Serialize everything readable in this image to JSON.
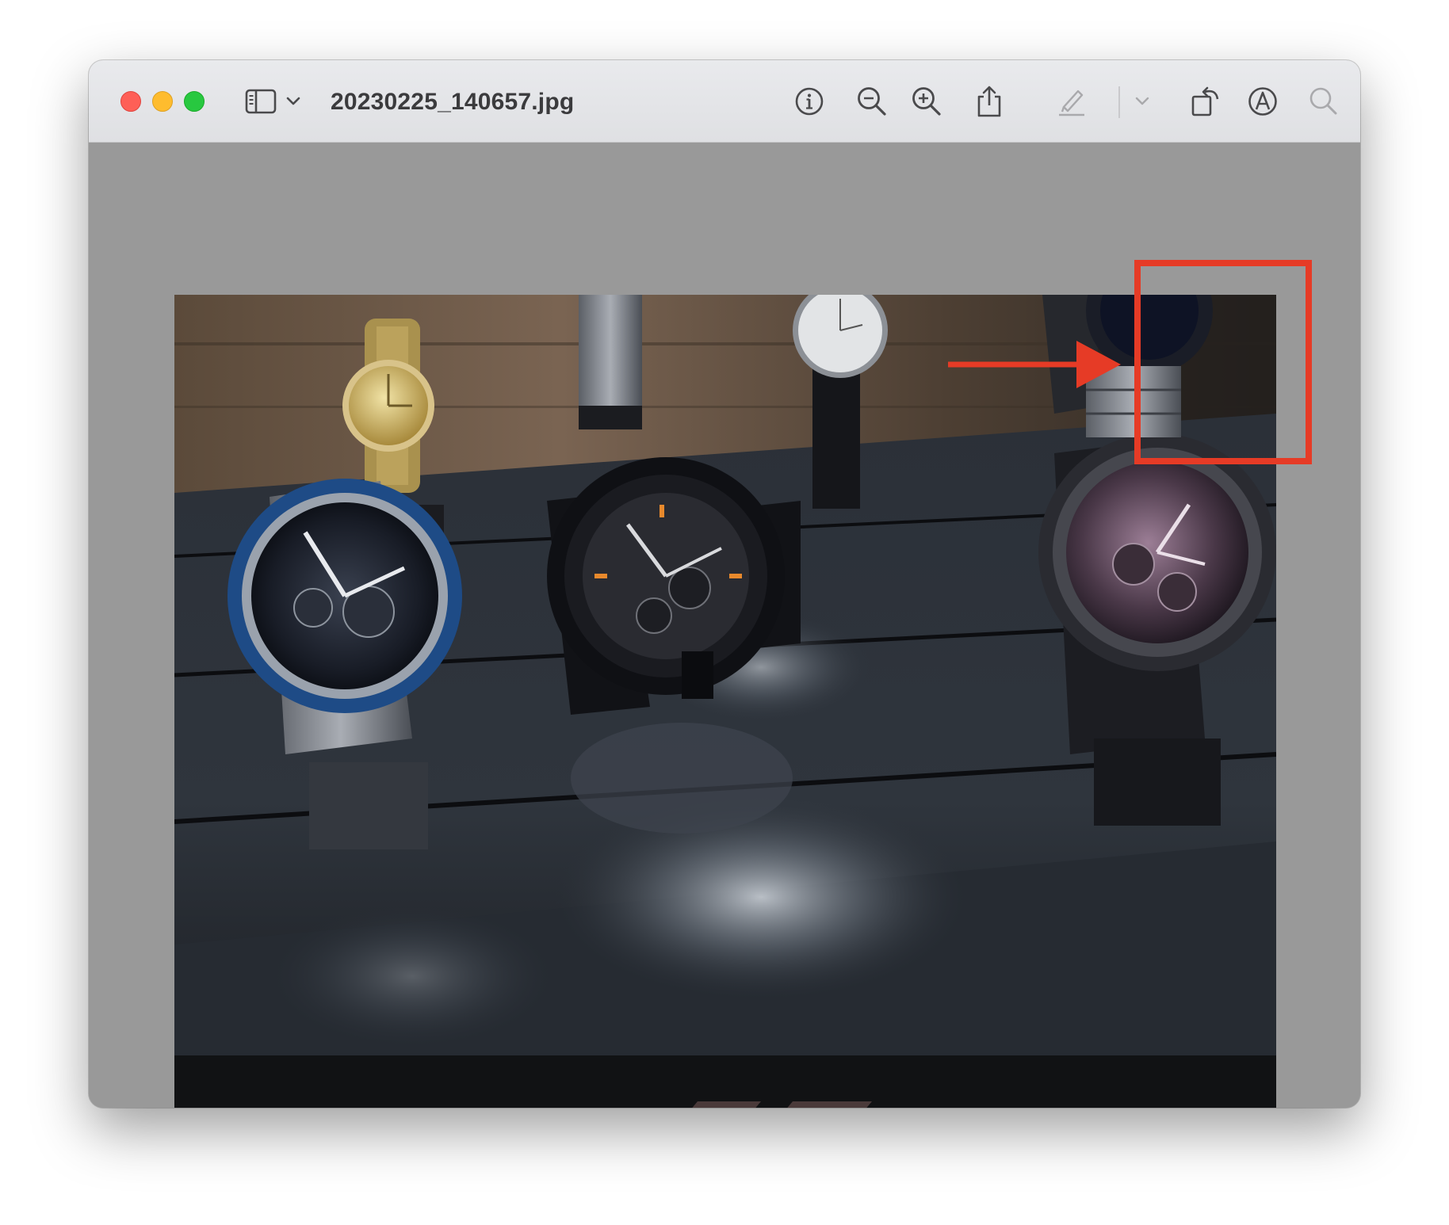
{
  "window": {
    "title": "20230225_140657.jpg"
  },
  "toolbar": {
    "sidebar_icon": "sidebar-toggle-icon",
    "sidebar_menu_icon": "chevron-down-icon",
    "info_icon": "info-icon",
    "zoom_out_icon": "zoom-out-icon",
    "zoom_in_icon": "zoom-in-icon",
    "share_icon": "share-icon",
    "highlight_icon": "highlighter-icon",
    "highlight_menu_icon": "chevron-down-icon",
    "rotate_icon": "rotate-icon",
    "markup_icon": "markup-icon",
    "search_icon": "search-icon"
  },
  "image": {
    "description_icon": "photo-of-watches-on-display",
    "annotation": {
      "highlight_color": "#e63b26",
      "arrow_color": "#e63b26"
    }
  },
  "colors": {
    "titlebar": "#e5e6e9",
    "canvas": "#999999",
    "close": "#fe5f57",
    "minimize": "#febc2e",
    "maximize": "#28c840"
  }
}
